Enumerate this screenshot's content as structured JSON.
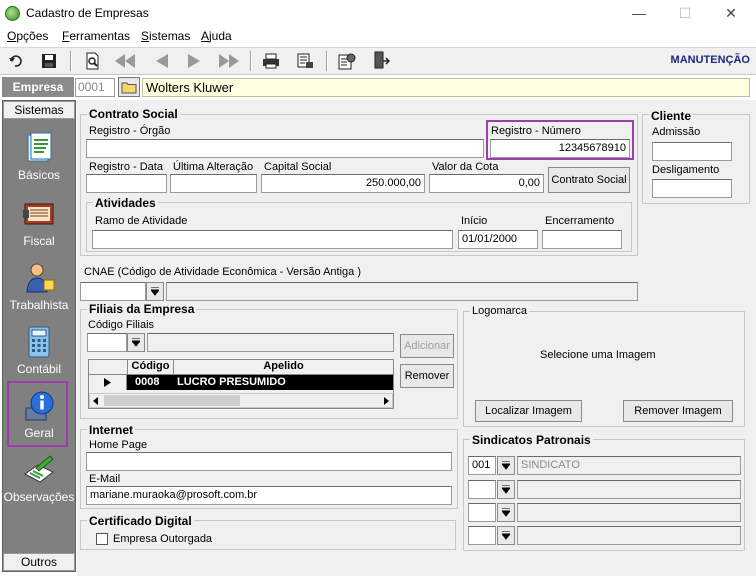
{
  "window": {
    "title": "Cadastro de Empresas",
    "minimize": "—",
    "maximize": "☐",
    "close": "✕"
  },
  "menu": [
    {
      "label_u": "O",
      "label_rest": "pções"
    },
    {
      "label_u": "F",
      "label_rest": "erramentas"
    },
    {
      "label_u": "S",
      "label_rest": "istemas"
    },
    {
      "label_u": "A",
      "label_rest": "juda"
    }
  ],
  "toolbar": {
    "mode": "MANUTENÇÃO"
  },
  "empresa": {
    "label": "Empresa",
    "code": "0001",
    "name": "Wolters Kluwer"
  },
  "sidebar": {
    "header": "Sistemas",
    "footer": "Outros",
    "items": [
      {
        "label": "Básicos"
      },
      {
        "label": "Fiscal"
      },
      {
        "label": "Trabalhista"
      },
      {
        "label": "Contábil"
      },
      {
        "label": "Geral"
      },
      {
        "label": "Observações"
      }
    ]
  },
  "contrato_social": {
    "title": "Contrato Social",
    "registro_orgao_label": "Registro - Órgão",
    "registro_orgao_value": "",
    "registro_numero_label": "Registro - Número",
    "registro_numero_value": "12345678910",
    "registro_data_label": "Registro - Data",
    "ultima_alteracao_label": "Última Alteração",
    "capital_social_label": "Capital Social",
    "capital_social_value": "250.000,00",
    "valor_cota_label": "Valor da Cota",
    "valor_cota_value": "0,00",
    "button_label": "Contrato Social"
  },
  "atividades": {
    "title": "Atividades",
    "ramo_label": "Ramo de Atividade",
    "inicio_label": "Início",
    "inicio_value": "01/01/2000",
    "encerramento_label": "Encerramento"
  },
  "cliente": {
    "title": "Cliente",
    "admissao_label": "Admissão",
    "desligamento_label": "Desligamento"
  },
  "cnae": {
    "label": "CNAE (Código de Atividade Econômica - Versão Antiga )"
  },
  "filiais": {
    "title": "Filiais da Empresa",
    "codigo_label": "Código Filiais",
    "adicionar": "Adicionar",
    "remover": "Remover",
    "columns": [
      "Código",
      "Apelido"
    ],
    "rows": [
      {
        "codigo": "0008",
        "apelido": "LUCRO PRESUMIDO"
      }
    ]
  },
  "logomarca": {
    "title": "Logomarca",
    "placeholder": "Selecione  uma  Imagem",
    "localizar": "Localizar Imagem",
    "remover": "Remover Imagem"
  },
  "internet": {
    "title": "Internet",
    "home_label": "Home Page",
    "home_value": "",
    "email_label": "E-Mail",
    "email_value": "mariane.muraoka@prosoft.com.br"
  },
  "sindicatos": {
    "title": "Sindicatos Patronais",
    "rows": [
      {
        "code": "001",
        "name": "SINDICATO"
      },
      {
        "code": "",
        "name": ""
      },
      {
        "code": "",
        "name": ""
      },
      {
        "code": "",
        "name": ""
      }
    ]
  },
  "certificado": {
    "title": "Certificado Digital",
    "checkbox_label": "Empresa Outorgada"
  },
  "colors": {
    "highlight": "#9b3fa8",
    "sidebar": "#808080",
    "company_bg": "#ffffe1",
    "mode_label": "#1a2a7a"
  }
}
